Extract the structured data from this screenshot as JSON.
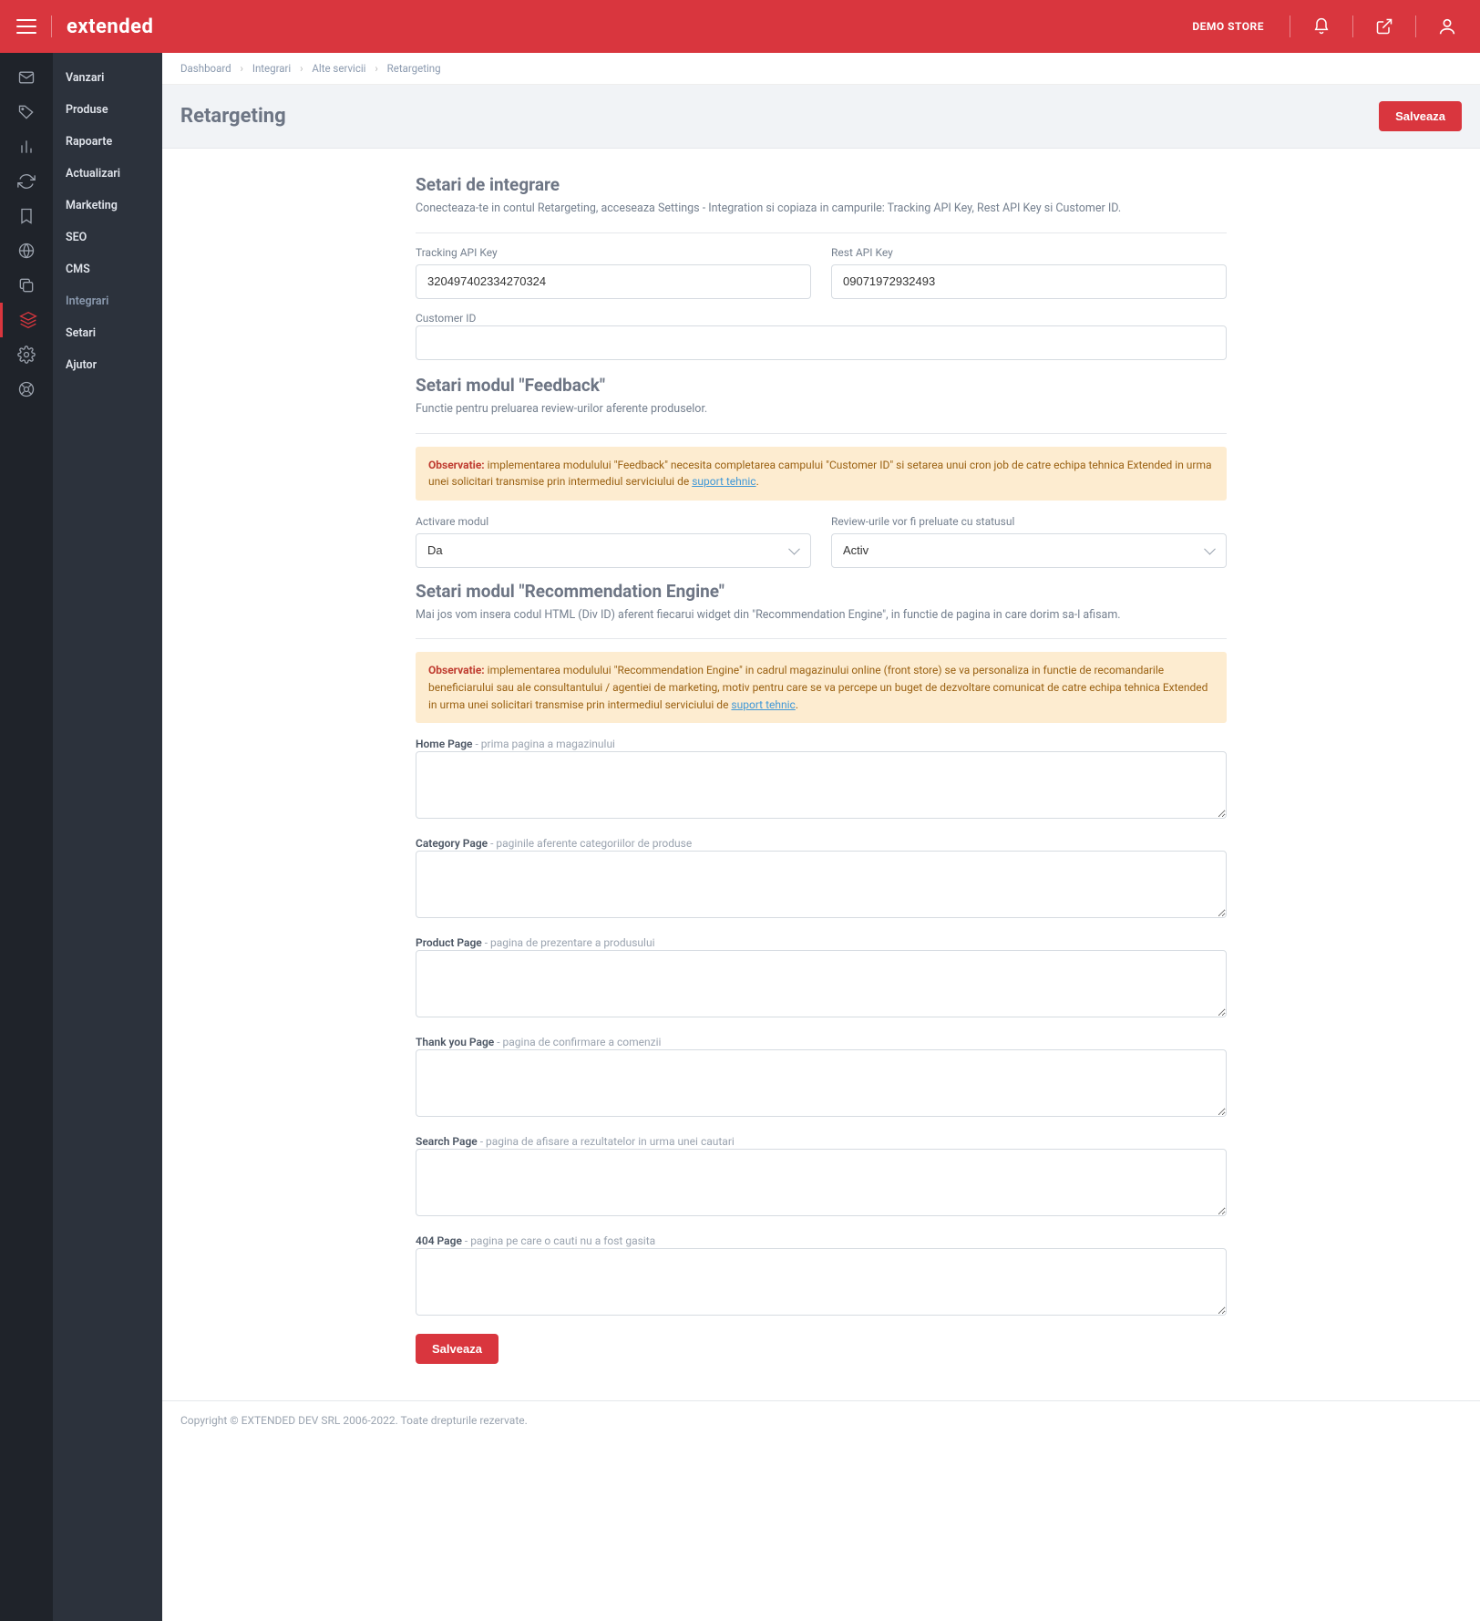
{
  "topbar": {
    "logo": "extended",
    "store_name": "DEMO STORE"
  },
  "sidebar": {
    "items": [
      {
        "label": "Vanzari"
      },
      {
        "label": "Produse"
      },
      {
        "label": "Rapoarte"
      },
      {
        "label": "Actualizari"
      },
      {
        "label": "Marketing"
      },
      {
        "label": "SEO"
      },
      {
        "label": "CMS"
      },
      {
        "label": "Integrari"
      },
      {
        "label": "Setari"
      },
      {
        "label": "Ajutor"
      }
    ]
  },
  "breadcrumb": {
    "dash": "Dashboard",
    "b1": "Integrari",
    "b2": "Alte servicii",
    "b3": "Retargeting"
  },
  "header": {
    "title": "Retargeting",
    "save": "Salveaza"
  },
  "section1": {
    "title": "Setari de integrare",
    "desc": "Conecteaza-te in contul Retargeting, acceseaza Settings - Integration si copiaza in campurile: Tracking API Key, Rest API Key si Customer ID.",
    "tracking_label": "Tracking API Key",
    "tracking_value": "320497402334270324",
    "rest_label": "Rest API Key",
    "rest_value": "09071972932493",
    "customer_label": "Customer ID"
  },
  "section2": {
    "title": "Setari modul \"Feedback\"",
    "desc": "Functie pentru preluarea review-urilor aferente produselor.",
    "alert_bold": "Observatie:",
    "alert_text": " implementarea modulului \"Feedback\" necesita completarea campului \"Customer ID\" si setarea unui cron job de catre echipa tehnica Extended in urma unei solicitari transmise prin intermediul serviciului de ",
    "alert_link": "suport tehnic",
    "alert_end": ".",
    "activate_label": "Activare modul",
    "activate_value": "Da",
    "status_label": "Review-urile vor fi preluate cu statusul",
    "status_value": "Activ"
  },
  "section3": {
    "title": "Setari modul \"Recommendation Engine\"",
    "desc": "Mai jos vom insera codul HTML (Div ID) aferent fiecarui widget din \"Recommendation Engine\", in functie de pagina in care dorim sa-l afisam.",
    "alert_bold": "Observatie:",
    "alert_text": " implementarea modulului \"Recommendation Engine\" in cadrul magazinului online (front store) se va personaliza in functie de recomandarile beneficiarului sau ale consultantului / agentiei de marketing, motiv pentru care se va percepe un buget de dezvoltare comunicat de catre echipa tehnica Extended in urma unei solicitari transmise prin intermediul serviciului de ",
    "alert_link": "suport tehnic",
    "alert_end": ".",
    "home_main": "Home Page",
    "home_sub": " - prima pagina a magazinului",
    "category_main": "Category Page",
    "category_sub": " - paginile aferente categoriilor de produse",
    "product_main": "Product Page",
    "product_sub": " - pagina de prezentare a produsului",
    "thankyou_main": "Thank you Page",
    "thankyou_sub": " - pagina de confirmare a comenzii",
    "search_main": "Search Page",
    "search_sub": " - pagina de afisare a rezultatelor in urma unei cautari",
    "nf_main": "404 Page",
    "nf_sub": " - pagina pe care o cauti nu a fost gasita",
    "save": "Salveaza"
  },
  "footer": {
    "text": "Copyright © EXTENDED DEV SRL 2006-2022. Toate drepturile rezervate."
  }
}
